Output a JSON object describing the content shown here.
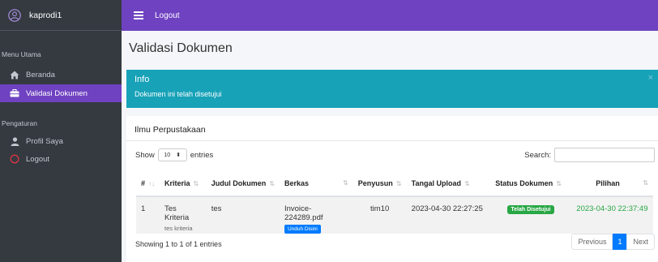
{
  "sidebar": {
    "username": "kaprodi1",
    "section_main": "Menu Utama",
    "section_settings": "Pengaturan",
    "items": [
      {
        "label": "Beranda",
        "icon": "home-icon"
      },
      {
        "label": "Validasi Dokumen",
        "icon": "briefcase-icon"
      },
      {
        "label": "Profil Saya",
        "icon": "user-icon"
      },
      {
        "label": "Logout",
        "icon": "power-icon"
      }
    ]
  },
  "topbar": {
    "logout_label": "Logout"
  },
  "page": {
    "title": "Validasi Dokumen"
  },
  "alert": {
    "title": "Info",
    "message": "Dokumen ini telah disetujui",
    "close": "×"
  },
  "card": {
    "title": "Ilmu Perpustakaan",
    "show_label": "Show",
    "entries_value": "10",
    "entries_label": "entries",
    "search_label": "Search:",
    "search_value": "",
    "showing_text": "Showing 1 to 1 of 1 entries",
    "prev_label": "Previous",
    "page_number": "1",
    "next_label": "Next"
  },
  "table": {
    "headers": [
      "#",
      "Kriteria",
      "Judul Dokumen",
      "Berkas",
      "Penyusun",
      "Tangal Upload",
      "Status Dokumen",
      "Pilihan"
    ],
    "rows": [
      {
        "no": "1",
        "kriteria": "Tes Kriteria",
        "kriteria_sub": "tes kriteria",
        "judul": "tes",
        "berkas": "Invoice-224289.pdf",
        "unduh_label": "Unduh Disini",
        "penyusun": "tim10",
        "tanggal": "2023-04-30 22:27:25",
        "status": "Telah Disetujui",
        "pilihan": "2023-04-30 22:37:49"
      }
    ]
  },
  "colors": {
    "sidebar_bg": "#343a40",
    "accent": "#6f42c1",
    "info": "#17a2b8",
    "success": "#28a745",
    "primary": "#007bff"
  }
}
